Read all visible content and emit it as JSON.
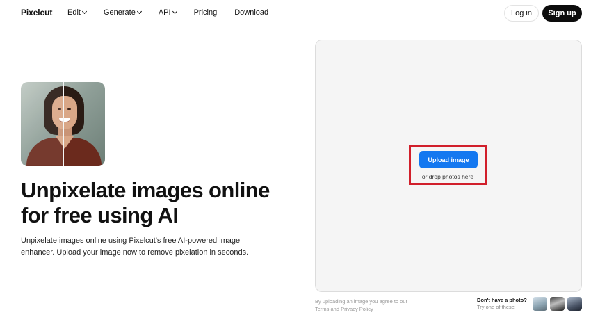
{
  "nav": {
    "logo": "Pixelcut",
    "links": [
      {
        "label": "Edit",
        "dropdown": true
      },
      {
        "label": "Generate",
        "dropdown": true
      },
      {
        "label": "API",
        "dropdown": true
      },
      {
        "label": "Pricing",
        "dropdown": false
      },
      {
        "label": "Download",
        "dropdown": false
      }
    ],
    "login_label": "Log in",
    "signup_label": "Sign up"
  },
  "hero": {
    "title": "Unpixelate images online for free using AI",
    "description": "Unpixelate images online using Pixelcut's free AI-powered image enhancer. Upload your image now to remove pixelation in seconds."
  },
  "upload": {
    "button_label": "Upload image",
    "drop_text": "or drop photos here",
    "terms_prefix": "By uploading an image you agree to our ",
    "terms_link": "Terms",
    "terms_and": " and ",
    "privacy_link": "Privacy Policy"
  },
  "samples": {
    "title": "Don't have a photo?",
    "subtitle": "Try one of these"
  },
  "colors": {
    "accent": "#1478f0",
    "highlight": "#d11f2b",
    "signup_bg": "#0c0c0c"
  }
}
